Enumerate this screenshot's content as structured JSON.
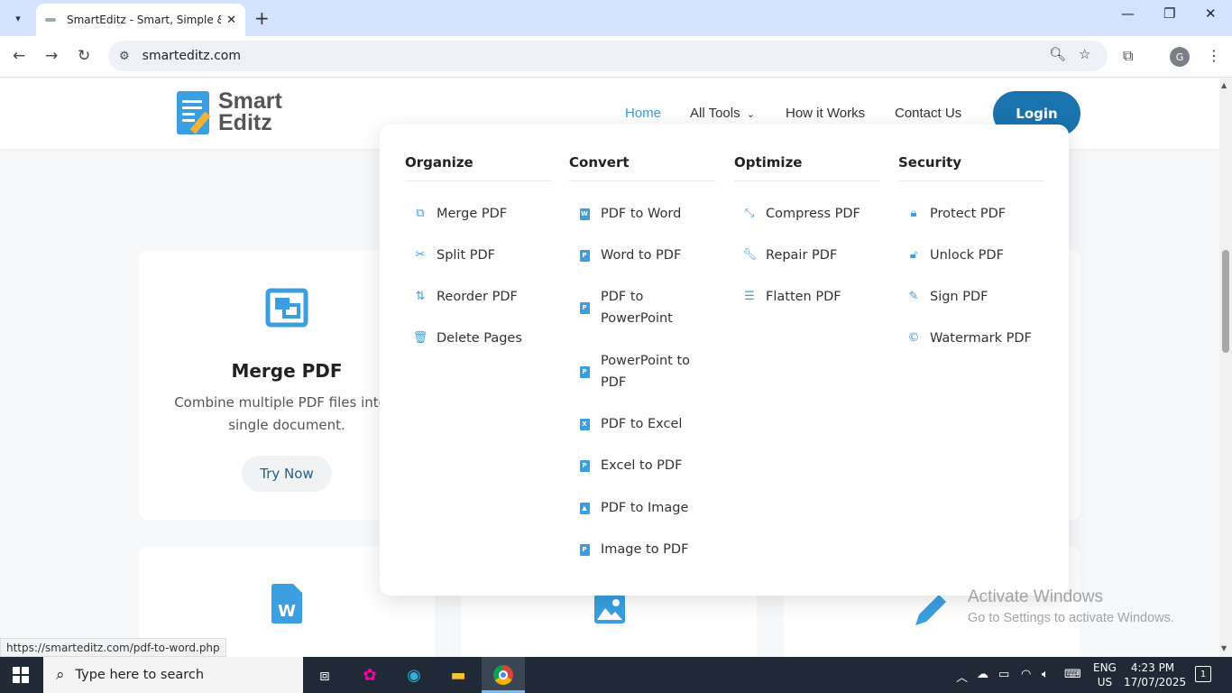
{
  "browser": {
    "tab_title": "SmartEditz - Smart, Simple & Secure",
    "close_tab": "✕",
    "new_tab": "+",
    "url": "smarteditz.com",
    "profile_initial": "G",
    "status_url": "https://smarteditz.com/pdf-to-word.php"
  },
  "site": {
    "logo_line1": "Smart",
    "logo_line2": "Editz",
    "nav": {
      "home": "Home",
      "all_tools": "All Tools",
      "how_it_works": "How it Works",
      "contact": "Contact Us",
      "login": "Login"
    },
    "card": {
      "title": "Merge PDF",
      "desc": "Combine multiple PDF files into a single document.",
      "button": "Try Now"
    }
  },
  "mega_menu": {
    "organize": {
      "heading": "Organize",
      "items": [
        "Merge PDF",
        "Split PDF",
        "Reorder PDF",
        "Delete Pages"
      ]
    },
    "convert": {
      "heading": "Convert",
      "items": [
        "PDF to Word",
        "Word to PDF",
        "PDF to PowerPoint",
        "PowerPoint to PDF",
        "PDF to Excel",
        "Excel to PDF",
        "PDF to Image",
        "Image to PDF"
      ]
    },
    "optimize": {
      "heading": "Optimize",
      "items": [
        "Compress PDF",
        "Repair PDF",
        "Flatten PDF"
      ]
    },
    "security": {
      "heading": "Security",
      "items": [
        "Protect PDF",
        "Unlock PDF",
        "Sign PDF",
        "Watermark PDF"
      ]
    }
  },
  "watermark": {
    "line1": "Activate Windows",
    "line2": "Go to Settings to activate Windows."
  },
  "taskbar": {
    "search_placeholder": "Type here to search",
    "lang_line1": "ENG",
    "lang_line2": "US",
    "time": "4:23 PM",
    "date": "17/07/2025",
    "notifications": "1"
  },
  "colors": {
    "brand": "#3a9ee0",
    "login_button": "#1a73ad",
    "taskbar": "#1f2a36"
  }
}
